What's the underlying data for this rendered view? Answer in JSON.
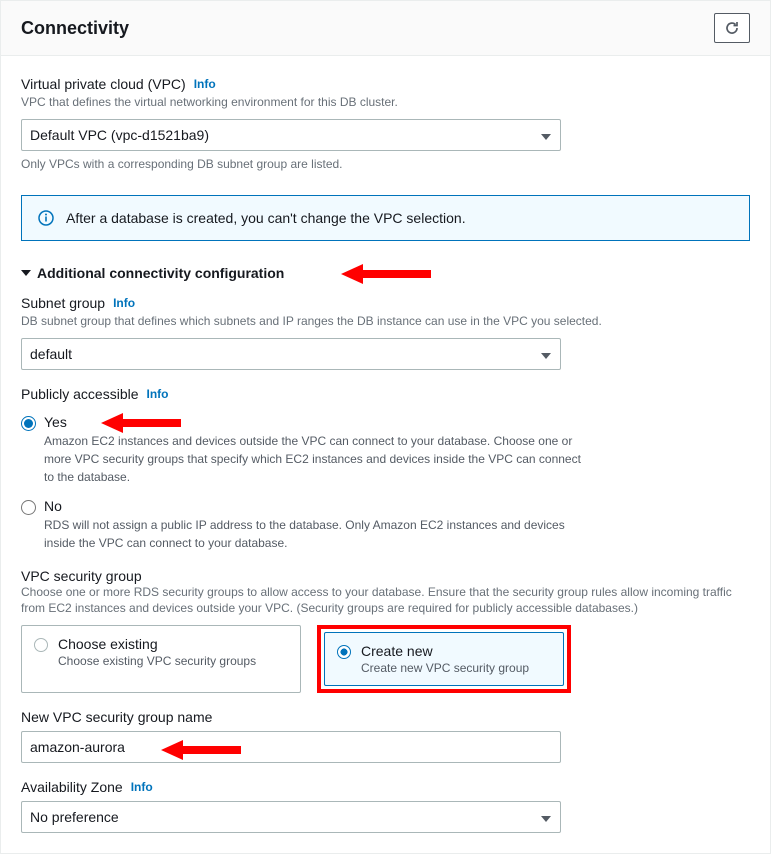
{
  "panel": {
    "title": "Connectivity"
  },
  "vpc": {
    "label": "Virtual private cloud (VPC)",
    "info": "Info",
    "hint": "VPC that defines the virtual networking environment for this DB cluster.",
    "value": "Default VPC (vpc-d1521ba9)",
    "note": "Only VPCs with a corresponding DB subnet group are listed."
  },
  "alert": {
    "text": "After a database is created, you can't change the VPC selection."
  },
  "expander": {
    "title": "Additional connectivity configuration"
  },
  "subnet": {
    "label": "Subnet group",
    "info": "Info",
    "hint": "DB subnet group that defines which subnets and IP ranges the DB instance can use in the VPC you selected.",
    "value": "default"
  },
  "public": {
    "label": "Publicly accessible",
    "info": "Info",
    "yes": {
      "label": "Yes",
      "desc": "Amazon EC2 instances and devices outside the VPC can connect to your database. Choose one or more VPC security groups that specify which EC2 instances and devices inside the VPC can connect to the database."
    },
    "no": {
      "label": "No",
      "desc": "RDS will not assign a public IP address to the database. Only Amazon EC2 instances and devices inside the VPC can connect to your database."
    }
  },
  "sg": {
    "label": "VPC security group",
    "hint": "Choose one or more RDS security groups to allow access to your database. Ensure that the security group rules allow incoming traffic from EC2 instances and devices outside your VPC. (Security groups are required for publicly accessible databases.)",
    "existing": {
      "title": "Choose existing",
      "desc": "Choose existing VPC security groups"
    },
    "create": {
      "title": "Create new",
      "desc": "Create new VPC security group"
    }
  },
  "newsg": {
    "label": "New VPC security group name",
    "value": "amazon-aurora"
  },
  "az": {
    "label": "Availability Zone",
    "info": "Info",
    "value": "No preference"
  }
}
